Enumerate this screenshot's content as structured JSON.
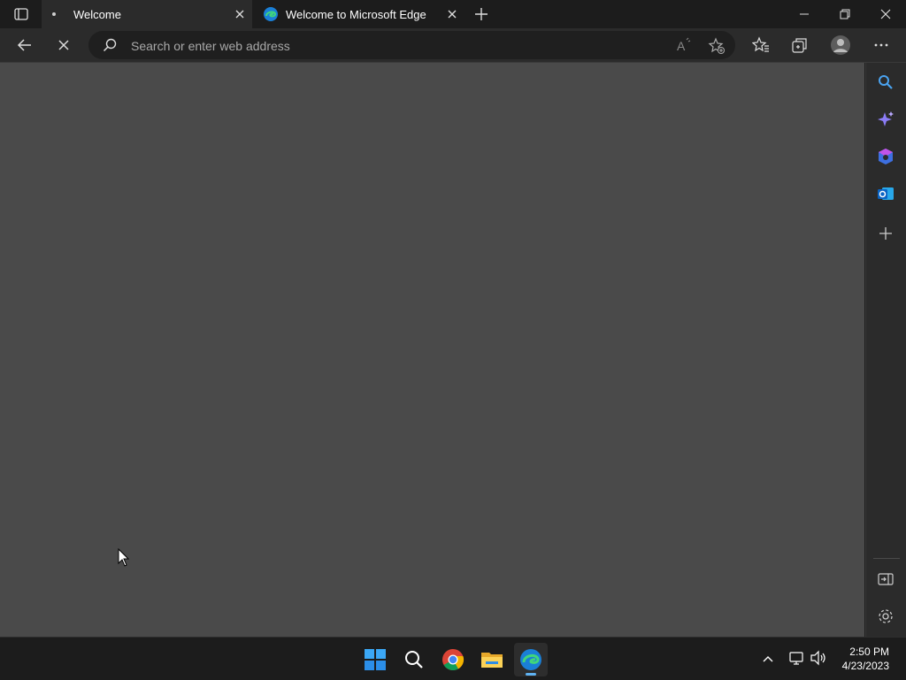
{
  "tabs": [
    {
      "label": "Welcome",
      "active": true
    },
    {
      "label": "Welcome to Microsoft Edge",
      "active": false
    }
  ],
  "address_bar": {
    "placeholder": "Search or enter web address"
  },
  "taskbar": {
    "apps": [
      "windows-start",
      "search",
      "google-chrome",
      "file-explorer",
      "microsoft-edge"
    ],
    "time": "2:50 PM",
    "date": "4/23/2023"
  },
  "sidebar": {
    "items": [
      "search",
      "copilot",
      "microsoft-365",
      "outlook",
      "add"
    ]
  },
  "colors": {
    "accent_edge": "#1fb5e8",
    "page_bg": "#4a4a4a",
    "chrome_bg": "#2b2b2b"
  }
}
